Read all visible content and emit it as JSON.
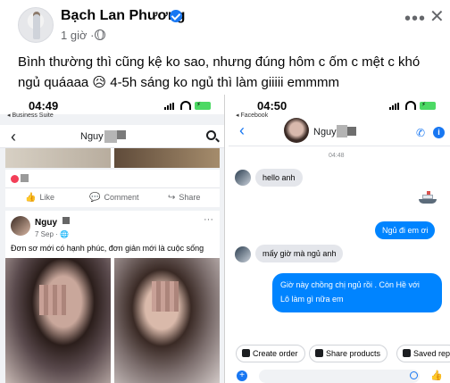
{
  "post": {
    "author": "Bạch Lan Phương",
    "time": "1 giờ ·",
    "more": "•••",
    "close": "✕",
    "caption": "Bình thường thì cũng kệ ko sao, nhưng đúng hôm c ốm c mệt c khó ngủ quáaaa 😥 4-5h sáng ko ngủ thì làm giiiii emmmm"
  },
  "left_phone": {
    "status_time": "04:49",
    "status_sub": "◂ Business Suite",
    "battery": "⚡",
    "nav_name": "Nguy",
    "actions": {
      "like": "Like",
      "comment": "Comment",
      "share": "Share"
    },
    "post2": {
      "name": "Nguy",
      "date": "7 Sep · 🌐",
      "more": "···",
      "text": "Đơn sơ mới có hạnh phúc, đơn giản mới là cuộc sống"
    }
  },
  "right_phone": {
    "status_time": "04:50",
    "status_sub": "◂ Facebook",
    "battery": "⚡",
    "nav_name": "Nguyễ",
    "chat_time": "04:48",
    "messages": [
      {
        "dir": "in",
        "text": "hello anh"
      },
      {
        "dir": "out",
        "text": "Ngủ đi em ơi"
      },
      {
        "dir": "in",
        "text": "mấy giờ mà ngủ anh"
      },
      {
        "dir": "out",
        "text": "Giờ này chồng chị ngủ rồi . Còn Hề với"
      },
      {
        "dir": "out",
        "text": "Lô làm gì nữa em"
      }
    ],
    "quick_replies": [
      "Create order",
      "Share products",
      "Saved rep"
    ]
  },
  "icons": {
    "verified": "verified-badge-icon",
    "globe": "globe-icon",
    "back": "back-arrow-icon",
    "search": "search-icon",
    "info": "info-icon",
    "call": "call-icon"
  },
  "colors": {
    "brand": "#1877f2",
    "bubble_out": "#0084ff",
    "bubble_in": "#e4e6eb"
  }
}
